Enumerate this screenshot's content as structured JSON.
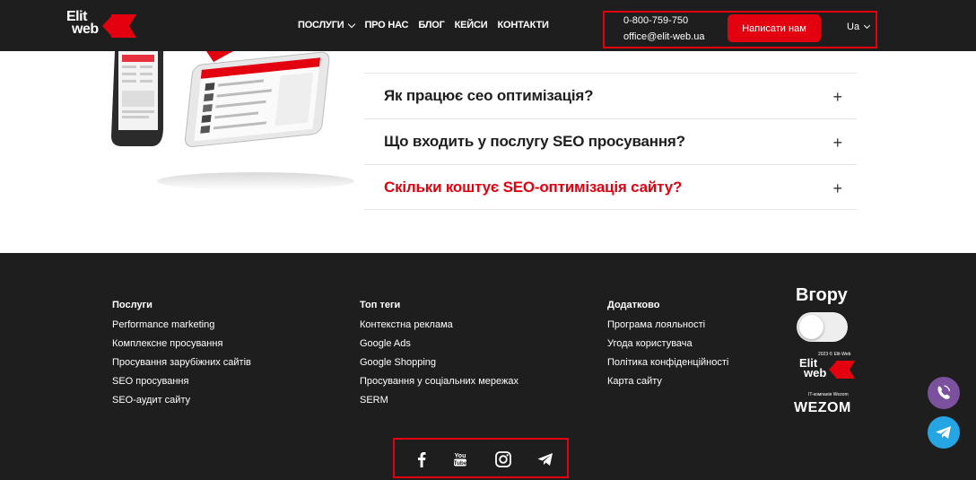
{
  "header": {
    "logo_line1": "Elit",
    "logo_line2": "web",
    "nav": [
      {
        "label": "ПОСЛУГИ",
        "has_dropdown": true
      },
      {
        "label": "ПРО НАС",
        "has_dropdown": false
      },
      {
        "label": "БЛОГ",
        "has_dropdown": false
      },
      {
        "label": "КЕЙСИ",
        "has_dropdown": false
      },
      {
        "label": "КОНТАКТИ",
        "has_dropdown": false
      }
    ],
    "phone": "0-800-759-750",
    "email": "office@elit-web.ua",
    "cta_label": "Написати нам",
    "language": "Ua"
  },
  "faq": [
    {
      "question": "Як працює сео оптимізація?",
      "active": false
    },
    {
      "question": "Що входить у послугу SEO просування?",
      "active": false
    },
    {
      "question": "Скільки коштує SEO-оптимізація сайту?",
      "active": true
    }
  ],
  "footer": {
    "col1": {
      "title": "Послуги",
      "links": [
        "Performance marketing",
        "Комплексне просування",
        "Просування зарубіжних сайтів",
        "SEO просування",
        "SEO-аудит сайту"
      ]
    },
    "col2": {
      "title": "Топ теги",
      "links": [
        "Контекстна реклама",
        "Google Ads",
        "Google Shopping",
        "Просування у соціальних мережах",
        "SERM"
      ]
    },
    "col3": {
      "title": "Додатково",
      "links": [
        "Програма лояльності",
        "Угода користувача",
        "Політика конфіденційності",
        "Карта сайту"
      ]
    },
    "scroll_top_label": "Вгору",
    "copyright": "2023 © Elit-Web",
    "logo_line1": "Elit",
    "logo_line2": "web",
    "partner_note": "IT-компанія Wezom",
    "partner_logo": "WEZOM",
    "social_icons": [
      "facebook-icon",
      "youtube-icon",
      "instagram-icon",
      "telegram-icon"
    ]
  },
  "floating": [
    "viber-icon",
    "telegram-icon"
  ],
  "colors": {
    "accent": "#e3000f",
    "dark_bg": "#1e1e1e",
    "viber": "#7b519d",
    "telegram": "#26a5e4"
  }
}
